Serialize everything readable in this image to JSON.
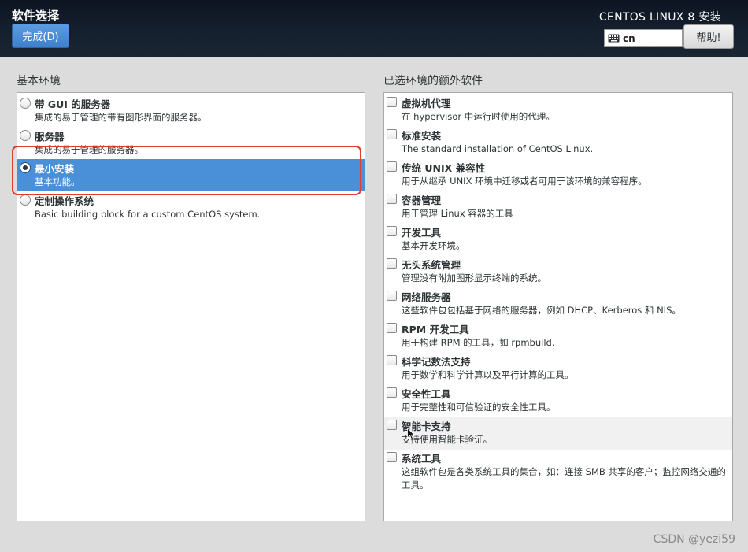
{
  "header": {
    "title": "软件选择",
    "done_label": "完成(D)",
    "product": "CENTOS LINUX 8 安装",
    "keyboard_layout": "cn",
    "help_label": "帮助!"
  },
  "base_environment": {
    "title": "基本环境",
    "selected": "最小安装",
    "items": [
      {
        "name": "带 GUI 的服务器",
        "desc": "集成的易于管理的带有图形界面的服务器。"
      },
      {
        "name": "服务器",
        "desc": "集成的易于管理的服务器。"
      },
      {
        "name": "最小安装",
        "desc": "基本功能。"
      },
      {
        "name": "定制操作系统",
        "desc": "Basic building block for a custom CentOS system."
      }
    ]
  },
  "addons": {
    "title": "已选环境的额外软件",
    "items": [
      {
        "name": "虚拟机代理",
        "desc": "在 hypervisor 中运行时使用的代理。"
      },
      {
        "name": "标准安装",
        "desc": "The standard installation of CentOS Linux."
      },
      {
        "name": "传统 UNIX 兼容性",
        "desc": "用于从继承 UNIX 环境中迁移或者可用于该环境的兼容程序。"
      },
      {
        "name": "容器管理",
        "desc": "用于管理 Linux 容器的工具"
      },
      {
        "name": "开发工具",
        "desc": "基本开发环境。"
      },
      {
        "name": "无头系统管理",
        "desc": "管理没有附加图形显示终端的系统。"
      },
      {
        "name": "网络服务器",
        "desc": "这些软件包包括基于网络的服务器，例如 DHCP、Kerberos 和 NIS。"
      },
      {
        "name": "RPM 开发工具",
        "desc": "用于构建 RPM 的工具，如 rpmbuild."
      },
      {
        "name": "科学记数法支持",
        "desc": "用于数学和科学计算以及平行计算的工具。"
      },
      {
        "name": "安全性工具",
        "desc": "用于完整性和可信验证的安全性工具。"
      },
      {
        "name": "智能卡支持",
        "desc": "支持使用智能卡验证。"
      },
      {
        "name": "系统工具",
        "desc": "这组软件包是各类系统工具的集合，如：连接 SMB 共享的客户；监控网络交通的工具。"
      }
    ]
  },
  "watermark": "CSDN @yezi59",
  "colors": {
    "selection": "#4a90d9",
    "header_bg": "#15202e",
    "annotation_box": "#e03c31"
  }
}
